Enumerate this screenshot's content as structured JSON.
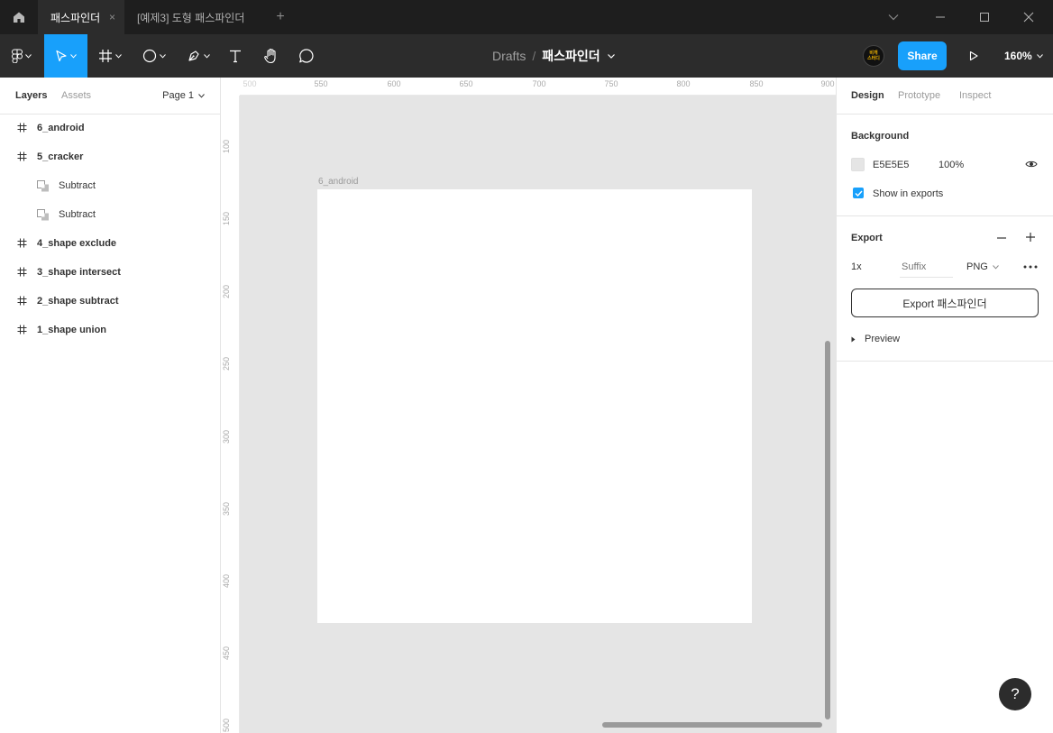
{
  "tabs": {
    "active": "패스파인더",
    "second": "[예제3] 도형 패스파인더",
    "close_glyph": "×",
    "add_glyph": "+"
  },
  "toolbar": {
    "breadcrumb_drafts": "Drafts",
    "breadcrumb_sep": "/",
    "file_name": "패스파인더",
    "avatar_line1": "비개",
    "avatar_line2": "스터디",
    "share_label": "Share",
    "zoom": "160%",
    "accent": "#18a0fb"
  },
  "left_panel": {
    "tab_layers": "Layers",
    "tab_assets": "Assets",
    "page": "Page 1",
    "layers": [
      {
        "label": "6_android"
      },
      {
        "label": "5_cracker"
      },
      {
        "label": "Subtract"
      },
      {
        "label": "Subtract"
      },
      {
        "label": "4_shape exclude"
      },
      {
        "label": "3_shape intersect"
      },
      {
        "label": "2_shape subtract"
      },
      {
        "label": "1_shape union"
      }
    ]
  },
  "canvas": {
    "ruler_x": [
      "500",
      "550",
      "600",
      "650",
      "700",
      "750",
      "800",
      "850",
      "900"
    ],
    "ruler_y": [
      "100",
      "150",
      "200",
      "250",
      "300",
      "350",
      "400",
      "450",
      "500"
    ],
    "frame_name": "6_android",
    "background": "#e5e5e5"
  },
  "right_panel": {
    "tab_design": "Design",
    "tab_prototype": "Prototype",
    "tab_inspect": "Inspect",
    "background_title": "Background",
    "bg_hex": "E5E5E5",
    "bg_opacity": "100%",
    "show_in_exports": "Show in exports",
    "export_title": "Export",
    "scale": "1x",
    "suffix_placeholder": "Suffix",
    "format": "PNG",
    "export_button": "Export 패스파인더",
    "preview": "Preview",
    "help": "?"
  }
}
